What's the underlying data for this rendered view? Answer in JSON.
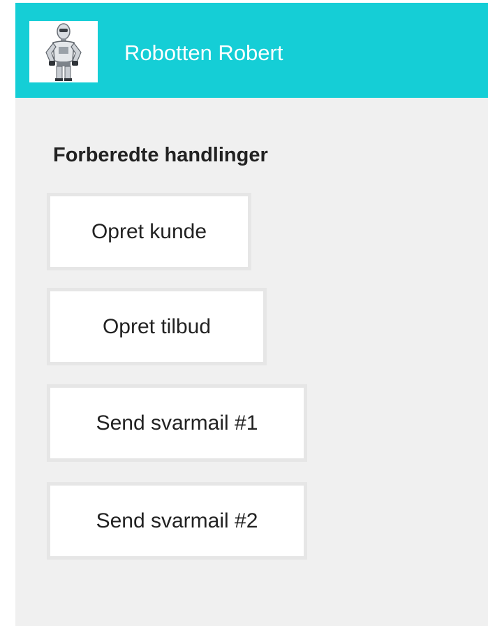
{
  "header": {
    "title": "Robotten Robert",
    "avatar_icon": "robot-icon",
    "background_color": "#15ced6"
  },
  "section": {
    "heading": "Forberedte handlinger"
  },
  "actions": [
    {
      "label": "Opret kunde"
    },
    {
      "label": "Opret tilbud"
    },
    {
      "label": "Send svarmail #1"
    },
    {
      "label": "Send svarmail #2"
    }
  ]
}
